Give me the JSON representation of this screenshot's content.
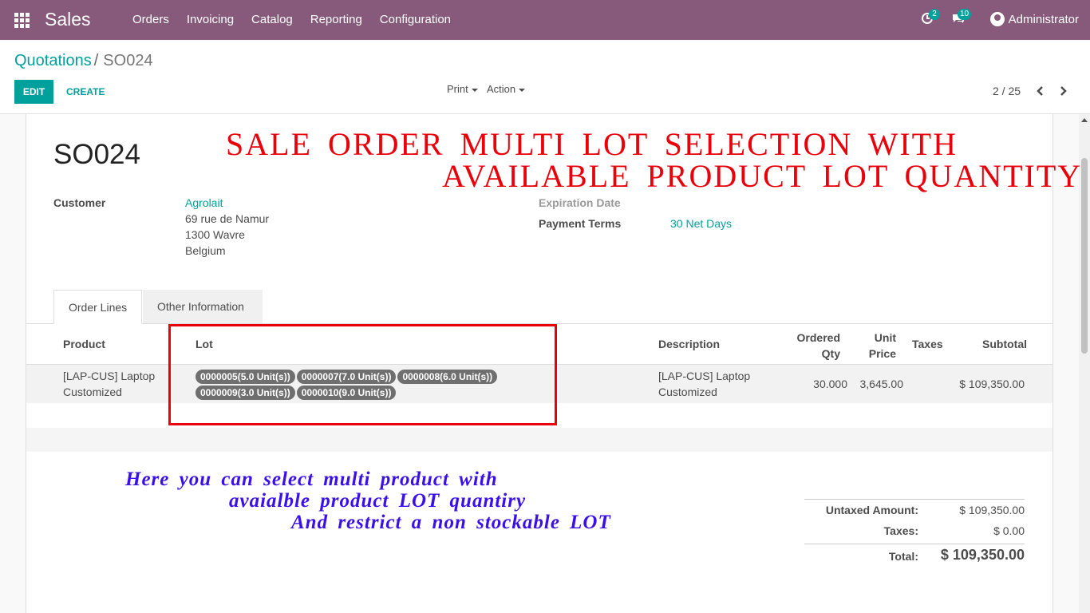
{
  "navbar": {
    "app_name": "Sales",
    "menu": [
      "Orders",
      "Invoicing",
      "Catalog",
      "Reporting",
      "Configuration"
    ],
    "activity_count": "2",
    "message_count": "10",
    "user": "Administrator",
    "color": "#875a7b"
  },
  "breadcrumb": {
    "parent": "Quotations",
    "separator": "/",
    "current": "SO024"
  },
  "actions": {
    "edit": "EDIT",
    "create": "CREATE",
    "print": "Print",
    "action": "Action"
  },
  "pager": {
    "value": "2 / 25"
  },
  "banner": {
    "line1": "SALE ORDER MULTI LOT SELECTION WITH",
    "line2": "AVAILABLE PRODUCT LOT QUANTITY"
  },
  "order": {
    "name": "SO024",
    "customer_label": "Customer",
    "customer_name": "Agrolait",
    "address": [
      "69 rue de Namur",
      "1300 Wavre",
      "Belgium"
    ],
    "expiration_label": "Expiration Date",
    "payment_terms_label": "Payment Terms",
    "payment_terms": "30 Net Days"
  },
  "tabs": [
    "Order Lines",
    "Other Information"
  ],
  "table": {
    "headers": {
      "product": "Product",
      "lot": "Lot",
      "description": "Description",
      "ordered_qty": [
        "Ordered",
        "Qty"
      ],
      "unit_price": [
        "Unit",
        "Price"
      ],
      "taxes": "Taxes",
      "subtotal": "Subtotal"
    },
    "rows": [
      {
        "product": [
          "[LAP-CUS] Laptop",
          "Customized"
        ],
        "lots": [
          "0000005(5.0 Unit(s))",
          "0000007(7.0 Unit(s))",
          "0000008(6.0 Unit(s))",
          "0000009(3.0 Unit(s))",
          "0000010(9.0 Unit(s))"
        ],
        "description": [
          "[LAP-CUS] Laptop",
          "Customized"
        ],
        "ordered_qty": "30.000",
        "unit_price": "3,645.00",
        "taxes": "",
        "subtotal": "$ 109,350.00"
      }
    ]
  },
  "note": {
    "line1": "Here you can select multi product with",
    "line2": "avaialble product LOT quantiry",
    "line3": "And restrict a non stockable LOT"
  },
  "totals": {
    "untaxed_label": "Untaxed Amount:",
    "untaxed_value": "$ 109,350.00",
    "taxes_label": "Taxes:",
    "taxes_value": "$ 0.00",
    "total_label": "Total:",
    "total_value": "$ 109,350.00"
  }
}
